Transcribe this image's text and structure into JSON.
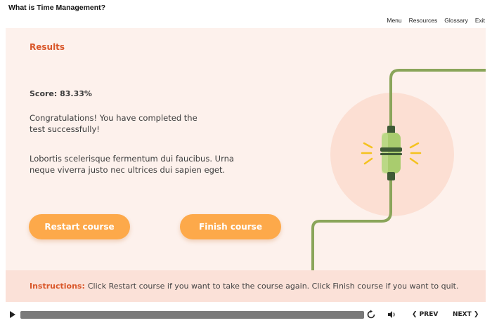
{
  "app": {
    "title": "What is Time Management?"
  },
  "nav": {
    "menu": "Menu",
    "resources": "Resources",
    "glossary": "Glossary",
    "exit": "Exit"
  },
  "results": {
    "title": "Results",
    "score": "Score: 83.33%",
    "message": "Congratulations! You have completed the test successfully!",
    "body": "Lobortis scelerisque fermentum dui faucibus. Urna neque viverra justo nec ultrices dui sapien eget."
  },
  "buttons": {
    "restart": "Restart course",
    "finish": "Finish course"
  },
  "instructions": {
    "label": "Instructions:",
    "text": "Click Restart course if you want to take the course again. Click Finish course if you want to quit."
  },
  "player": {
    "prev": "❮ PREV",
    "next": "NEXT ❯"
  },
  "colors": {
    "accent": "#d9572a",
    "button": "#fda94a",
    "slide_bg": "#fdf1ec",
    "cable": "#8aa55a"
  },
  "icons": [
    "play-icon",
    "replay-icon",
    "volume-icon",
    "cable-connector-icon"
  ]
}
